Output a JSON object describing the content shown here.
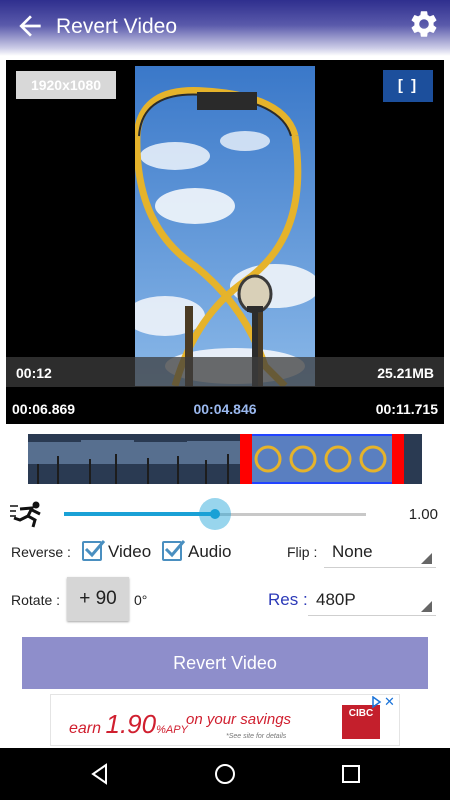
{
  "app_bar": {
    "title": "Revert Video",
    "back_icon": "arrow-back-icon",
    "settings_icon": "gear-icon"
  },
  "player": {
    "resolution_badge": "1920x1080",
    "fullscreen_label": "[ ]",
    "duration": "00:12",
    "file_size": "25.21MB",
    "trim_start": "00:06.869",
    "current_time": "00:04.846",
    "trim_end": "00:11.715"
  },
  "speed": {
    "icon": "runner-icon",
    "value_label": "1.00",
    "slider_fraction": 0.5
  },
  "reverse": {
    "label": "Reverse :",
    "video_label": "Video",
    "video_checked": true,
    "audio_label": "Audio",
    "audio_checked": true
  },
  "flip": {
    "label": "Flip :",
    "selected": "None"
  },
  "rotate": {
    "label": "Rotate :",
    "button_label": "+ 90",
    "degrees": "0°"
  },
  "resolution": {
    "label": "Res :",
    "selected": "480P"
  },
  "action": {
    "revert_label": "Revert Video"
  },
  "ad": {
    "earn": "earn",
    "rate": "1.90",
    "rate_unit": "%APY",
    "rest": "on your savings",
    "disclaimer": "*See site for details",
    "brand": "CIBC"
  },
  "colors": {
    "accent": "#1aa1d6",
    "primary_button": "#8e8ecb",
    "res_label": "#2c3ab8",
    "fullscreen_button": "#1c4f9c",
    "timeline_selection": "#ff0000"
  },
  "navbar": {
    "back_icon": "nav-back-icon",
    "home_icon": "nav-home-icon",
    "recents_icon": "nav-recents-icon"
  }
}
